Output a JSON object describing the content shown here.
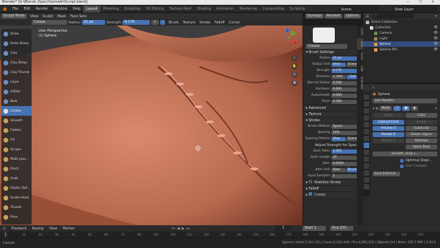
{
  "window": {
    "title": "Blender* [G:\\Blends (Spec)\\GameArtSculpt.blend]",
    "controls": "— ☐ ✕"
  },
  "menus": [
    "File",
    "Edit",
    "Render",
    "Window",
    "Help"
  ],
  "workspaces": [
    {
      "label": "Layout",
      "active": true
    },
    {
      "label": "Modeling"
    },
    {
      "label": "Sculpting"
    },
    {
      "label": "UV Editing"
    },
    {
      "label": "Texture Paint"
    },
    {
      "label": "Shading"
    },
    {
      "label": "Animation"
    },
    {
      "label": "Rendering"
    },
    {
      "label": "Compositing"
    },
    {
      "label": "Scripting"
    }
  ],
  "scene": {
    "label": "Scene",
    "view_layer": "View Layer"
  },
  "viewport_header": {
    "mode": "Sculpt Mode",
    "view": "View",
    "sculpt": "Sculpt",
    "mask": "Mask",
    "face_sets": "Face Sets",
    "right": "Dyntopo",
    "remesh": "Remesh",
    "options": "Options"
  },
  "tool_header": {
    "brush": "Crease",
    "radius_label": "Radius",
    "radius": "31 px",
    "strength_label": "Strength",
    "strength": "0.176",
    "direction_plus": "+",
    "direction_minus": "-",
    "brush_menu": "Brush",
    "texture": "Texture",
    "stroke": "Stroke",
    "falloff": "Falloff",
    "cursor": "Cursor"
  },
  "viewport_info": {
    "line1": "User Perspective",
    "line2": "(1) Sphere"
  },
  "gizmo": {
    "x": "X",
    "y": "Y",
    "z": "Z"
  },
  "tools": [
    {
      "label": "Draw",
      "color": "#6f8ebf"
    },
    {
      "label": "Draw Sharp",
      "color": "#6f8ebf"
    },
    {
      "label": "Clay",
      "color": "#6f8ebf"
    },
    {
      "label": "Clay Strips",
      "color": "#6f8ebf"
    },
    {
      "label": "Clay Thumb",
      "color": "#6f8ebf"
    },
    {
      "label": "Layer",
      "color": "#6f8ebf"
    },
    {
      "label": "Inflate",
      "color": "#6f8ebf"
    },
    {
      "label": "Blob",
      "color": "#6f8ebf"
    },
    {
      "label": "Crease",
      "color": "#e0e0e0",
      "active": true
    },
    {
      "label": "Smooth",
      "color": "#c9a15a"
    },
    {
      "label": "Flatten",
      "color": "#c9a15a"
    },
    {
      "label": "Fill",
      "color": "#c9a15a"
    },
    {
      "label": "Scrape",
      "color": "#c9a15a"
    },
    {
      "label": "Multi-plan...",
      "color": "#c9a15a"
    },
    {
      "label": "Pinch",
      "color": "#c9a15a"
    },
    {
      "label": "Grab",
      "color": "#c9a15a"
    },
    {
      "label": "Elastic Def...",
      "color": "#c9a15a"
    },
    {
      "label": "Snake Hook",
      "color": "#c9a15a"
    },
    {
      "label": "Thumb",
      "color": "#c9a15a"
    },
    {
      "label": "Pose",
      "color": "#c9a15a"
    }
  ],
  "brush_panel": {
    "brush_name": "Crease",
    "brush_settings": "Brush Settings",
    "rows": [
      {
        "label": "Radius",
        "value": "31 px"
      },
      {
        "label": "Radius Unit",
        "value": "View",
        "value2": "Scene"
      },
      {
        "label": "Strength",
        "value": "0.176"
      },
      {
        "label": "Direction",
        "value": "+ Add",
        "value2": "- Sub"
      },
      {
        "label": "Normal Radius",
        "value": "0.500"
      },
      {
        "label": "Hardness",
        "value": "0.000"
      },
      {
        "label": "Autosmooth",
        "value": "0.000"
      },
      {
        "label": "Pinch",
        "value": "0.500"
      }
    ],
    "advanced": "Advanced",
    "texture": "Texture",
    "stroke": "Stroke",
    "stroke_method_label": "Stroke Method",
    "stroke_method": "Space",
    "spacing_label": "Spacing",
    "spacing": "10%",
    "spacing_distance_label": "Spacing Distanc",
    "spacing_distance": "View",
    "spacing_distance2": "Scene",
    "adjust_strength": "Adjust Strength for Spacing",
    "dash_ratio_label": "Dash Ratio",
    "dash_ratio": "1.000",
    "dash_length_label": "Dash Length",
    "dash_length": "20",
    "jitter_label": "Jitter",
    "jitter": "0.0000",
    "jitter_unit_label": "Jitter Unit",
    "jitter_unit": "View",
    "jitter_unit2": "Brush",
    "input_samples_label": "Input Samples",
    "input_samples": "1",
    "stabilize": "Stabilize Stroke",
    "falloff": "Falloff",
    "cursor": "Cursor"
  },
  "side_tabs": [
    "Item",
    "Tool",
    "View",
    "Edit",
    "Animate"
  ],
  "outliner": {
    "header": "Scene Collection",
    "items": [
      {
        "label": "Collection",
        "indent": 1,
        "color": "#dcdcdc"
      },
      {
        "label": "Camera",
        "indent": 2,
        "color": "#6e8a4a"
      },
      {
        "label": "Light",
        "indent": 2,
        "color": "#8f8b5c"
      },
      {
        "label": "Sphere",
        "indent": 2,
        "color": "#e09848",
        "selected": true
      },
      {
        "label": "Sphere.001",
        "indent": 2,
        "color": "#e09848"
      }
    ]
  },
  "modifier_panel": {
    "object": "Sphere",
    "add_modifier": "Add Modifier",
    "modifier_name": "Multi",
    "apply": "Apply",
    "copy": "Copy",
    "catmull": "Catmull-Clark",
    "simple": "Simple",
    "preview_label": "Preview",
    "preview": "5",
    "subdivide": "Subdivide",
    "render_label": "Render",
    "render": "6",
    "delete_higher": "Delete Higher",
    "quality_label": "Quality",
    "quality": "3",
    "reshape": "Reshape",
    "apply_base": "Apply Base",
    "smooth": "Smooth, keep c...",
    "optimal_display": "Optimal Displ...",
    "use_creases": "Use Creases",
    "save_external": "Save External..."
  },
  "timeline": {
    "playback": "Playback",
    "keying": "Keying",
    "view": "View",
    "marker": "Marker",
    "current": "1",
    "start_label": "Start",
    "start": "1",
    "end_label": "End",
    "end": "250",
    "ticks": [
      "0",
      "10",
      "20",
      "30",
      "40",
      "50",
      "60",
      "70",
      "80",
      "90",
      "100",
      "110",
      "120",
      "130",
      "140",
      "150",
      "160",
      "170",
      "180",
      "190",
      "200",
      "210",
      "220",
      "230",
      "240",
      "250"
    ]
  },
  "status": {
    "left": "Cancel",
    "right": "Sphere | Verts:2,161,541 | Faces:2,032,446 | Tris:4,065,212 | Objects:1/4 | Mem: 325.7 MiB | 2.83.0"
  },
  "colors": {
    "accent": "#4772b3",
    "skin": "#b86a4f"
  }
}
